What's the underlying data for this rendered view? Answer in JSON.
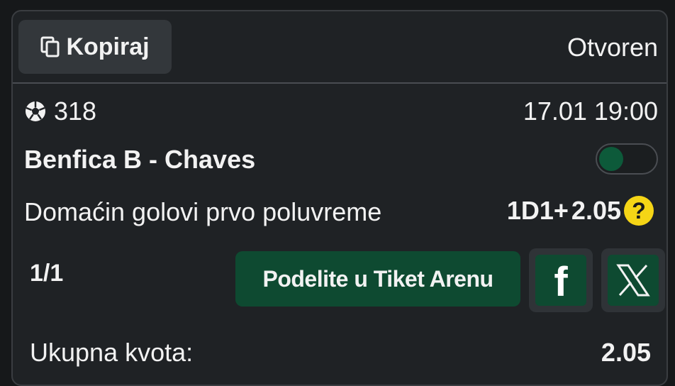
{
  "header": {
    "copy_label": "Kopiraj",
    "status": "Otvoren"
  },
  "match": {
    "sport_icon": "soccer-ball-icon",
    "id": "318",
    "datetime": "17.01 19:00",
    "teams": "Benfica B - Chaves",
    "market": "Domaćin golovi prvo poluvreme",
    "pick": "1D1+",
    "odds": "2.05",
    "help_glyph": "?"
  },
  "footer": {
    "count": "1/1",
    "share_label": "Podelite u Tiket Arenu",
    "facebook_glyph": "f",
    "total_label": "Ukupna kvota:",
    "total_value": "2.05"
  },
  "colors": {
    "background": "#1f2225",
    "accent_green": "#0e4a31",
    "help_yellow": "#f5d516"
  }
}
